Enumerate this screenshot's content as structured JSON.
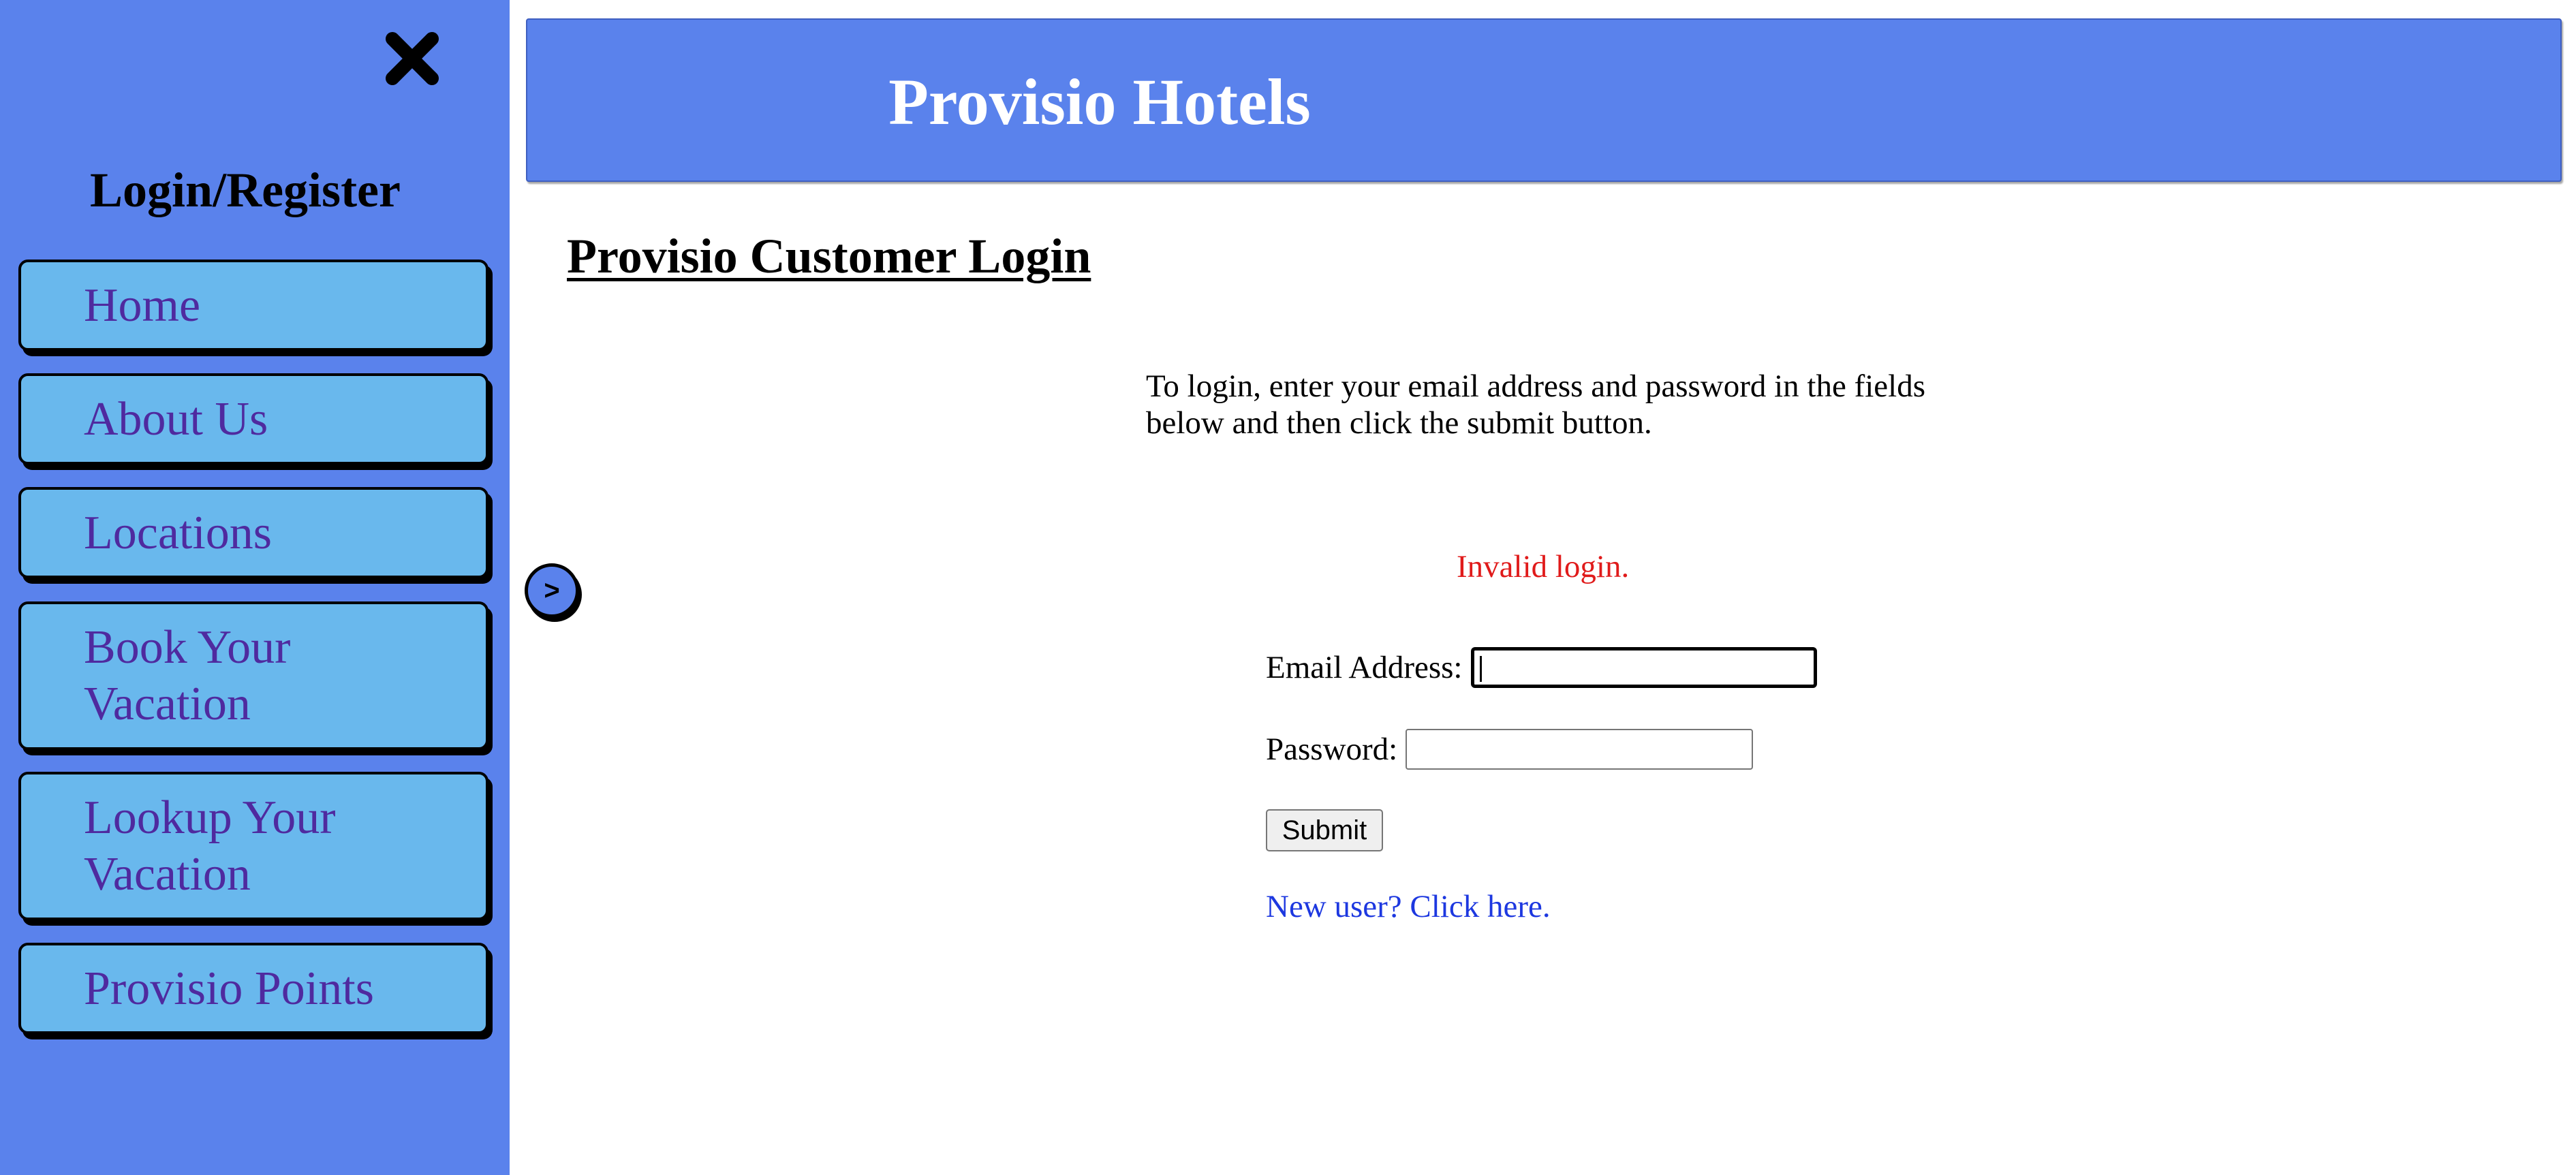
{
  "sidebar": {
    "title": "Login/Register",
    "close_icon": "close-icon",
    "items": [
      {
        "label": "Home"
      },
      {
        "label": "About Us"
      },
      {
        "label": "Locations"
      },
      {
        "label_line1": "Book Your",
        "label_line2": "Vacation"
      },
      {
        "label_line1": "Lookup Your",
        "label_line2": "Vacation"
      },
      {
        "label": "Provisio Points"
      }
    ]
  },
  "header": {
    "title": "Provisio Hotels"
  },
  "main": {
    "page_title": "Provisio Customer Login",
    "instructions": "To login, enter your email address and password in the fields below and then click the submit button.",
    "toggle_label": ">",
    "error": "Invalid login.",
    "email_label": "Email Address:",
    "email_value": "",
    "password_label": "Password:",
    "password_value": "",
    "submit_label": "Submit",
    "register_link": "New user? Click here."
  },
  "colors": {
    "sidebar_bg": "#5a82ec",
    "nav_button_bg": "#69b8ed",
    "nav_text": "#4f2a9f",
    "error": "#e01b1b",
    "link": "#1d38e0"
  }
}
